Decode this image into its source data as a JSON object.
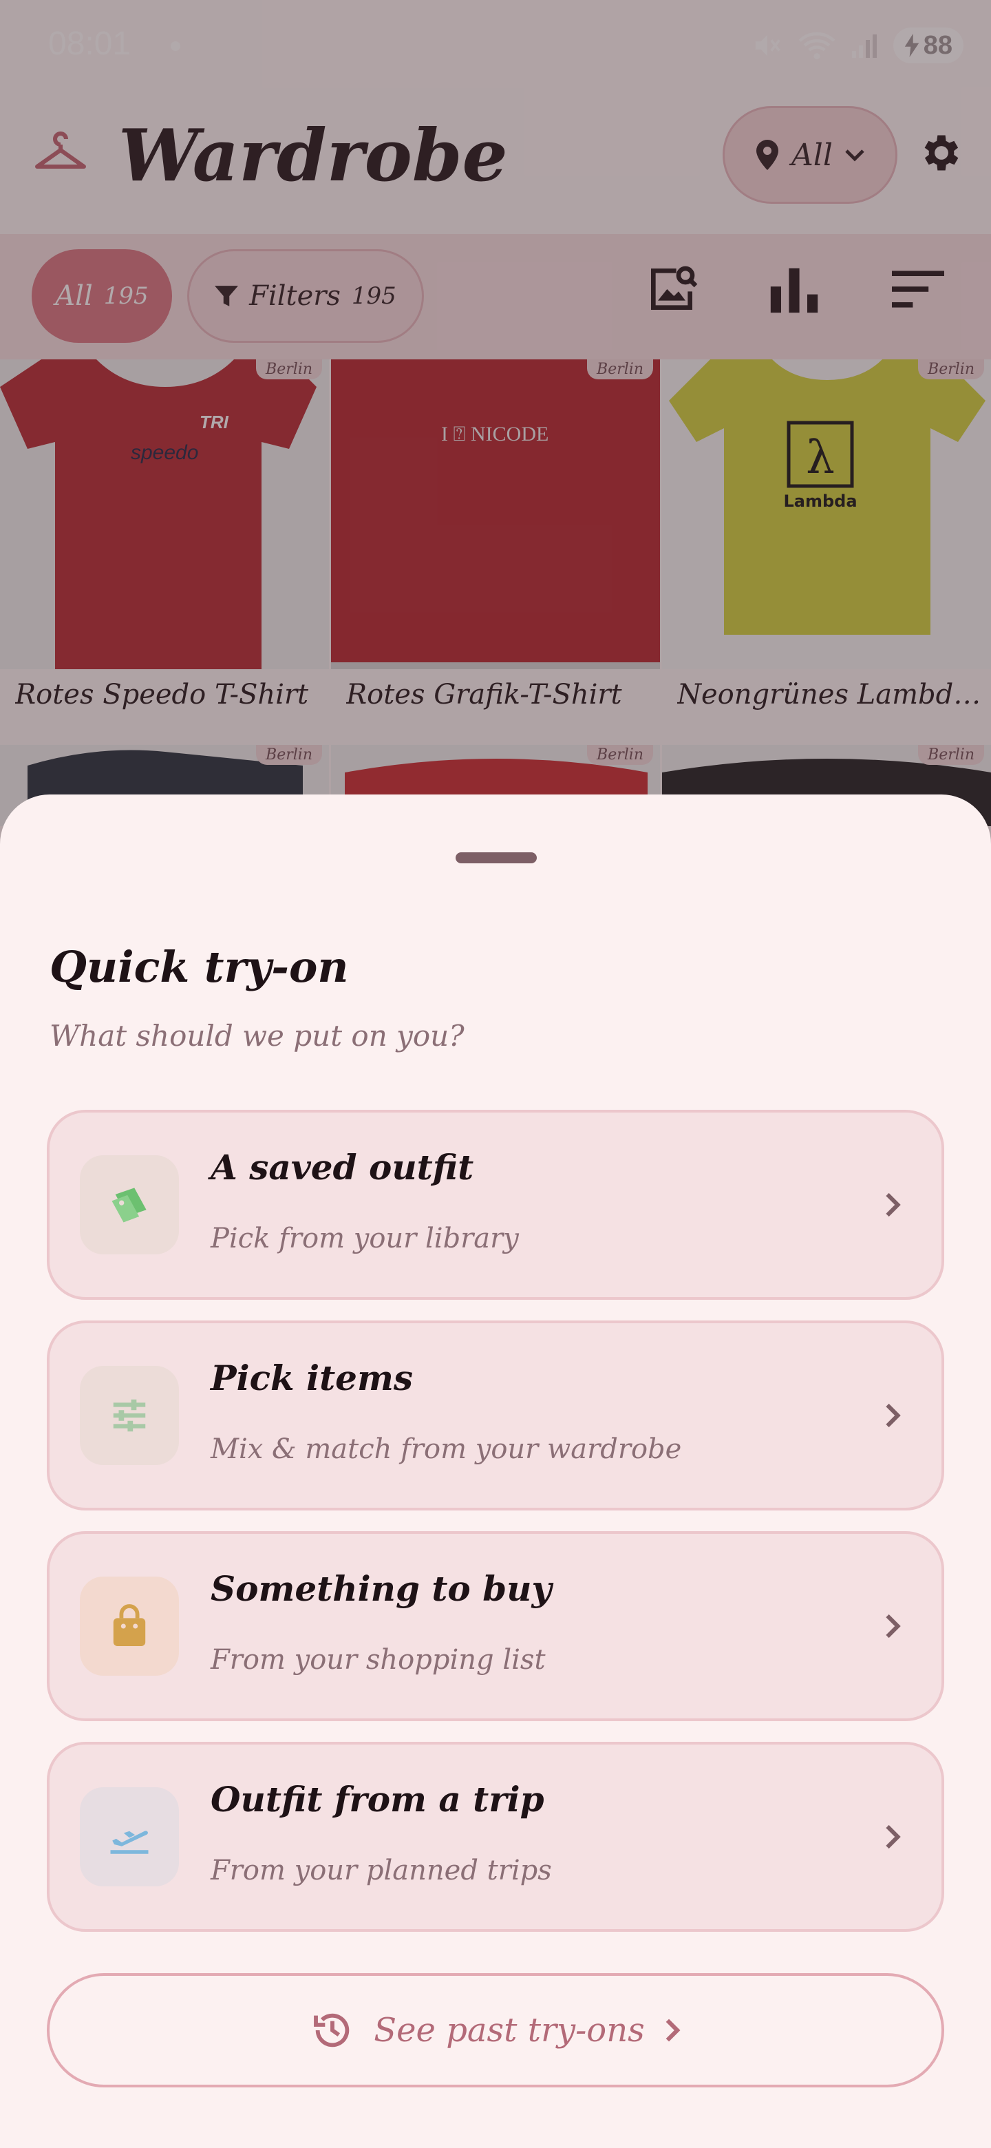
{
  "status_bar": {
    "time": "08:01",
    "battery": "88"
  },
  "app_bar": {
    "title": "Wardrobe",
    "location_filter": "All"
  },
  "filter_bar": {
    "all_chip": {
      "label": "All",
      "count": "195"
    },
    "filters_chip": {
      "label": "Filters",
      "count": "195"
    }
  },
  "grid": {
    "items": [
      {
        "name": "Rotes Speedo T-Shirt",
        "tag": "Berlin",
        "color": "#b3252e"
      },
      {
        "name": "Rotes Grafik-T-Shirt",
        "tag": "Berlin",
        "color": "#b3222a",
        "print": "I ⍰ NICODE"
      },
      {
        "name": "Neongrünes Lambda T-S...",
        "tag": "Berlin",
        "color": "#cfd13a",
        "print": "λ",
        "print_sub": "Lambda"
      },
      {
        "name": "",
        "tag": "Berlin",
        "color": "#1f2b38"
      },
      {
        "name": "",
        "tag": "Berlin",
        "color": "#c8262b"
      },
      {
        "name": "",
        "tag": "Berlin",
        "color": "#1b1b1d"
      }
    ]
  },
  "sheet": {
    "title": "Quick try-on",
    "subtitle": "What should we put on you?",
    "options": [
      {
        "title": "A saved outfit",
        "subtitle": "Pick from your library",
        "icon": "tag-icon",
        "icon_color": "#6cc070",
        "icon_bg": "#ecdcd8"
      },
      {
        "title": "Pick items",
        "subtitle": "Mix & match from your wardrobe",
        "icon": "sliders-icon",
        "icon_color": "#a8c9a6",
        "icon_bg": "#ecdcd8"
      },
      {
        "title": "Something to buy",
        "subtitle": "From your shopping list",
        "icon": "shopping-bag-icon",
        "icon_color": "#d4a24c",
        "icon_bg": "#f3d9cf"
      },
      {
        "title": "Outfit from a trip",
        "subtitle": "From your planned trips",
        "icon": "airplane-icon",
        "icon_color": "#7db7dc",
        "icon_bg": "#e7dde2"
      }
    ],
    "past_button": "See past try-ons"
  }
}
